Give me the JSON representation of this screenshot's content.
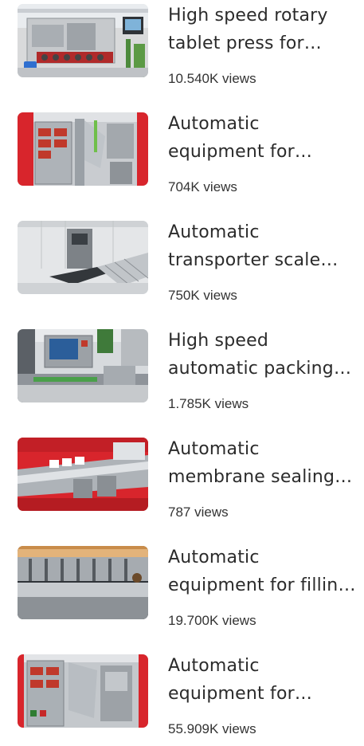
{
  "videos": [
    {
      "title": "High speed rotary tablet press for pharmaceutical industry",
      "views": "10.540K views",
      "thumb_icon": "tablet-press-machine-thumbnail"
    },
    {
      "title": "Automatic equipment for packaging",
      "views": "704K views",
      "thumb_icon": "packaging-machine-thumbnail"
    },
    {
      "title": "Automatic transporter scale with rollers",
      "views": "750K views",
      "thumb_icon": "transporter-scale-thumbnail"
    },
    {
      "title": "High speed automatic packing line",
      "views": "1.785K views",
      "thumb_icon": "automatic-line-thumbnail"
    },
    {
      "title": "Automatic membrane sealing machine",
      "views": "787 views",
      "thumb_icon": "membrane-machine-thumbnail"
    },
    {
      "title": "Automatic equipment for filling sticks",
      "views": "19.700K views",
      "thumb_icon": "stick-filling-thumbnail"
    },
    {
      "title": "Automatic equipment for packaging sachets",
      "views": "55.909K views",
      "thumb_icon": "sachet-packaging-thumbnail"
    }
  ],
  "colors": {
    "accent_red": "#d8252c",
    "steel": "#b9bdc2",
    "text": "#2b2b2b"
  }
}
